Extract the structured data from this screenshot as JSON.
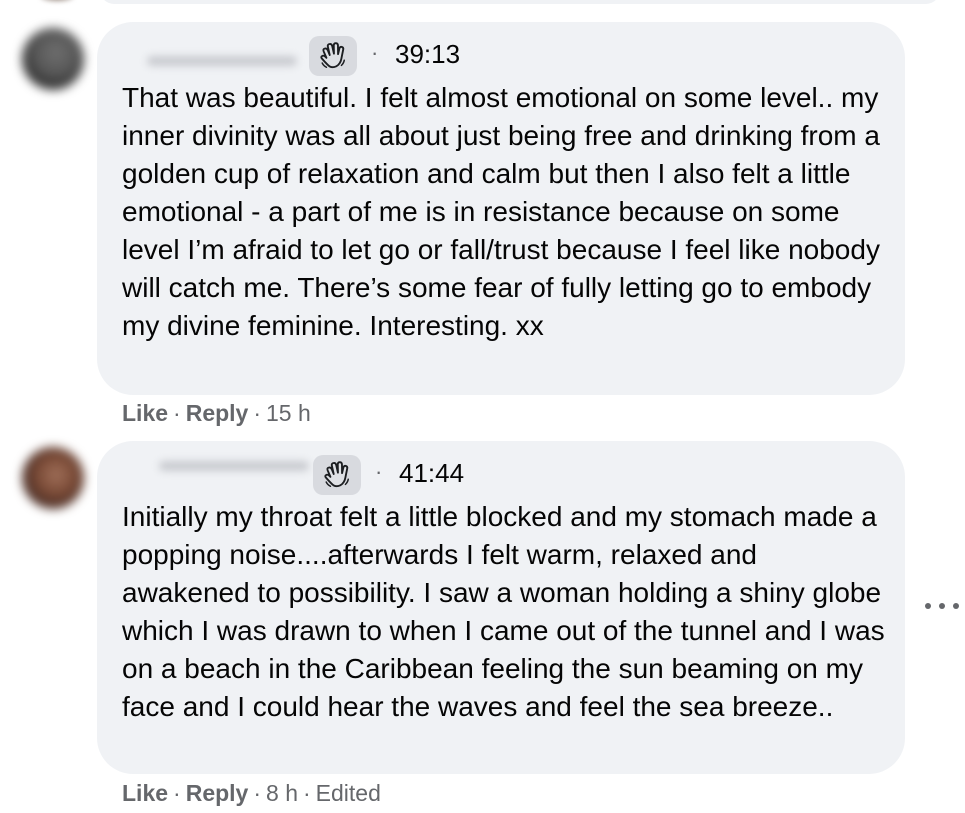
{
  "comments": [
    {
      "timestamp": "39:13",
      "text": "That was beautiful. I felt almost emotional on some level.. my inner divinity was all about just being free and drinking from a golden cup of relaxation and calm but then I also felt a little emotional - a part of me is in resistance because on some level I’m afraid to let go or fall/trust because I feel like nobody will catch me. There’s some fear of fully letting go to embody my divine feminine. Interesting. xx",
      "like_label": "Like",
      "reply_label": "Reply",
      "age": "15 h",
      "badge_icon": "waving-hand-icon"
    },
    {
      "timestamp": "41:44",
      "text": "Initially my throat felt a little blocked and my stomach made a popping noise....afterwards I felt warm, relaxed and awakened to possibility. I saw a woman holding a shiny globe which I was drawn to when I came out of the tunnel and I was on a beach in the Caribbean feeling the sun beaming on my face and I could hear the waves and feel the sea breeze..",
      "like_label": "Like",
      "reply_label": "Reply",
      "age": "8 h",
      "edited_label": "Edited",
      "badge_icon": "waving-hand-icon"
    }
  ],
  "colors": {
    "bubble_bg": "#f0f2f5",
    "text": "#050505",
    "secondary_text": "#65676b",
    "badge_bg": "#d8dadf"
  }
}
